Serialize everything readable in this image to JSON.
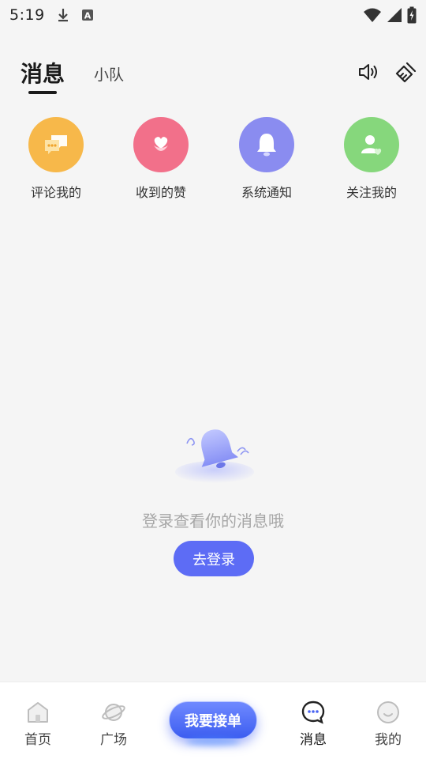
{
  "status_bar": {
    "time": "5:19",
    "icons": [
      "download-icon",
      "accessibility-a-icon",
      "wifi-icon",
      "cellular-signal-icon",
      "battery-charging-icon"
    ]
  },
  "header": {
    "tabs": [
      {
        "label": "消息",
        "active": true
      },
      {
        "label": "小队",
        "active": false
      }
    ],
    "icons": [
      "speaker-icon",
      "broom-icon"
    ]
  },
  "categories": [
    {
      "label": "评论我的",
      "icon": "chat-bubbles-icon",
      "color": "#f7b84a"
    },
    {
      "label": "收到的赞",
      "icon": "heart-flower-icon",
      "color": "#f2708a"
    },
    {
      "label": "系统通知",
      "icon": "bell-icon",
      "color": "#8a8cf0"
    },
    {
      "label": "关注我的",
      "icon": "user-heart-icon",
      "color": "#86d77c"
    }
  ],
  "empty_state": {
    "illustration": "bell-illustration-icon",
    "message": "登录查看你的消息哦",
    "button_label": "去登录",
    "button_color": "#5d6cf5"
  },
  "bottom_nav": {
    "items": [
      {
        "label": "首页",
        "icon": "home-icon"
      },
      {
        "label": "广场",
        "icon": "planet-icon"
      },
      {
        "label": "消息",
        "icon": "message-icon",
        "active": true
      },
      {
        "label": "我的",
        "icon": "smile-icon"
      }
    ],
    "center_button": "我要接单",
    "accent_color": "#4a64f2"
  }
}
